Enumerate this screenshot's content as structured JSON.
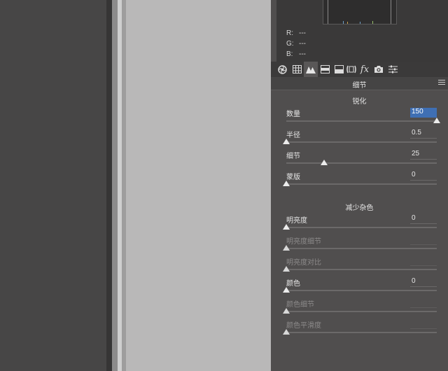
{
  "histogram": {
    "r_label": "R:",
    "r_value": "---",
    "g_label": "G:",
    "g_value": "---",
    "b_label": "B:",
    "b_value": "---"
  },
  "tabs": [
    {
      "name": "tab-basic-aperture",
      "icon": "aperture-icon"
    },
    {
      "name": "tab-tone-curve",
      "icon": "grid-icon"
    },
    {
      "name": "tab-detail",
      "icon": "mountain-icon",
      "active": true
    },
    {
      "name": "tab-hsl",
      "icon": "hsl-icon"
    },
    {
      "name": "tab-split-toning",
      "icon": "split-toning-icon"
    },
    {
      "name": "tab-lens-corrections",
      "icon": "lens-icon"
    },
    {
      "name": "tab-effects",
      "icon": "fx-icon",
      "text": "fx"
    },
    {
      "name": "tab-camera-calibration",
      "icon": "camera-icon"
    },
    {
      "name": "tab-presets",
      "icon": "sliders-icon"
    }
  ],
  "panel": {
    "title": "细节",
    "sharpening": {
      "title": "锐化",
      "amount": {
        "label": "数量",
        "value": "150",
        "fraction": 1.0
      },
      "radius": {
        "label": "半径",
        "value": "0.5",
        "fraction": 0.0
      },
      "detail": {
        "label": "细节",
        "value": "25",
        "fraction": 0.25
      },
      "masking": {
        "label": "蒙版",
        "value": "0",
        "fraction": 0.0
      }
    },
    "noise_reduction": {
      "title": "减少杂色",
      "luminance": {
        "label": "明亮度",
        "value": "0",
        "fraction": 0.0
      },
      "luminance_detail": {
        "label": "明亮度细节",
        "value": "",
        "fraction": 0.0
      },
      "luminance_contrast": {
        "label": "明亮度对比",
        "value": "",
        "fraction": 0.0
      },
      "color": {
        "label": "颜色",
        "value": "0",
        "fraction": 0.0
      },
      "color_detail": {
        "label": "颜色细节",
        "value": "",
        "fraction": 0.0
      },
      "color_smoothness": {
        "label": "颜色平滑度",
        "value": "",
        "fraction": 0.0
      }
    }
  }
}
